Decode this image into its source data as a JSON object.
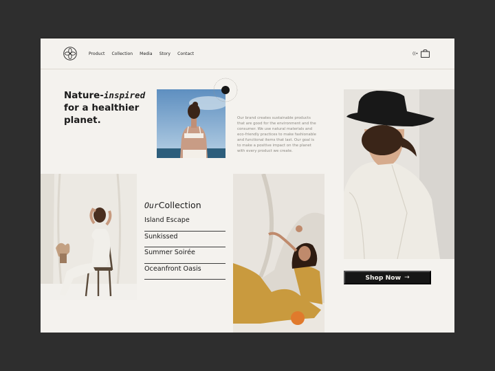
{
  "nav": {
    "items": [
      {
        "label": "Product"
      },
      {
        "label": "Collection"
      },
      {
        "label": "Media"
      },
      {
        "label": "Story"
      },
      {
        "label": "Contact"
      }
    ],
    "audio_glyph": "((•",
    "bag_icon": "shopping-bag-icon"
  },
  "hero": {
    "title_part1": "Nature-",
    "title_italic": "inspired",
    "title_part2": "for a healthier planet."
  },
  "about": {
    "text": "Our brand creates sustainable products that are good for the environment and the consumer. We use natural materials and eco-friendly practices to make fashionable and functional items that last. Our goal is to make a positive impact on the planet with every product we create."
  },
  "collection": {
    "title_italic": "Our",
    "title_rest": "Collection",
    "items": [
      {
        "label": "Island Escape"
      },
      {
        "label": "Sunkissed"
      },
      {
        "label": "Summer Soirée"
      },
      {
        "label": "Oceanfront Oasis"
      }
    ]
  },
  "cta": {
    "label": "Shop Now",
    "arrow": "→"
  },
  "colors": {
    "background": "#f4f2ee",
    "text": "#1a1a1a",
    "muted": "#8a8780",
    "button": "#161616",
    "mustard": "#c99a3e"
  }
}
